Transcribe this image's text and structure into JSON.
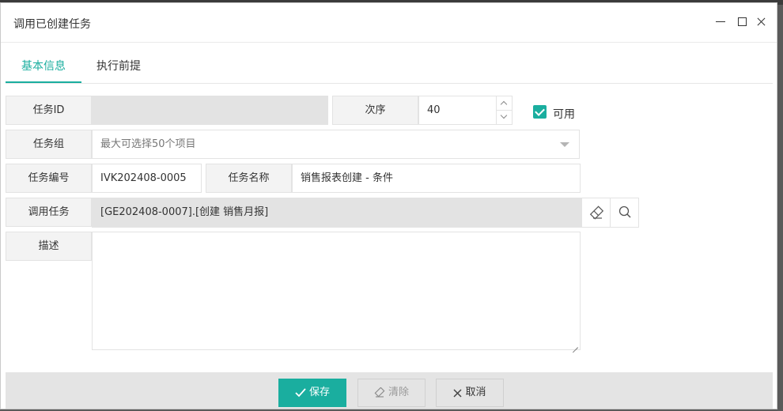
{
  "dialog": {
    "title": "调用已创建任务"
  },
  "tabs": [
    {
      "label": "基本信息",
      "active": true
    },
    {
      "label": "执行前提",
      "active": false
    }
  ],
  "form": {
    "task_id": {
      "label": "任务ID",
      "value": ""
    },
    "order": {
      "label": "次序",
      "value": "40"
    },
    "enabled": {
      "label": "可用",
      "checked": true
    },
    "task_group": {
      "label": "任务组",
      "placeholder": "最大可选择50个项目"
    },
    "task_code": {
      "label": "任务编号",
      "value": "IVK202408-0005"
    },
    "task_name": {
      "label": "任务名称",
      "value": "销售报表创建 - 条件"
    },
    "invoke_task": {
      "label": "调用任务",
      "value": "[GE202408-0007].[创建 销售月报]"
    },
    "description": {
      "label": "描述",
      "value": ""
    }
  },
  "footer": {
    "save_label": "保存",
    "clear_label": "清除",
    "cancel_label": "取消"
  },
  "colors": {
    "accent": "#1aae9f"
  }
}
